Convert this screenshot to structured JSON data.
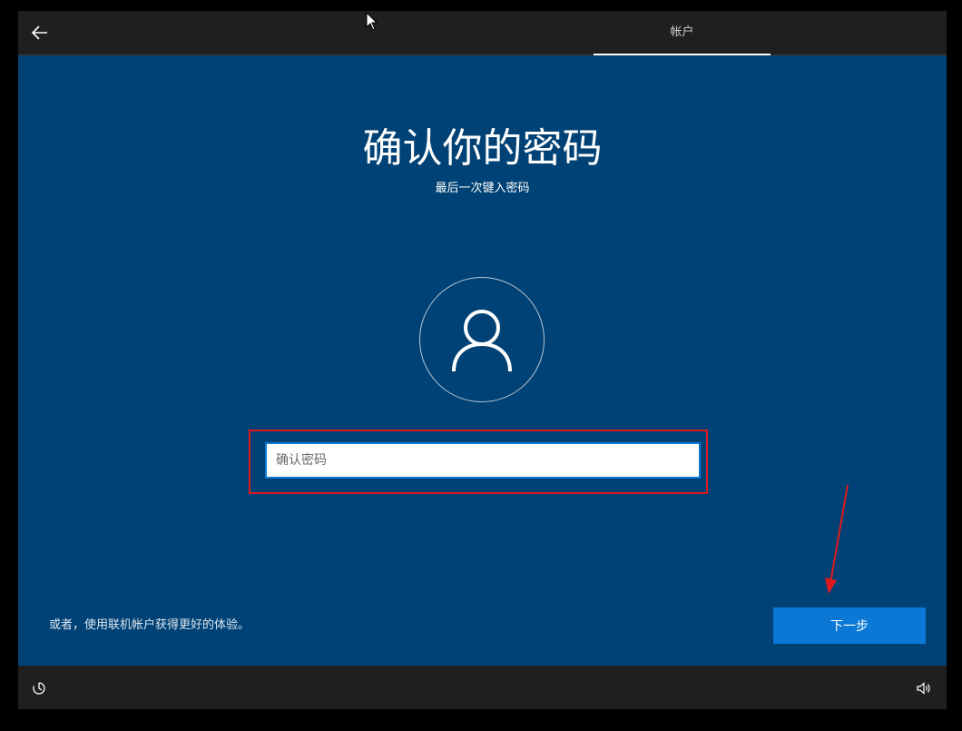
{
  "header": {
    "tab_label": "帐户"
  },
  "main": {
    "title": "确认你的密码",
    "subtitle": "最后一次键入密码",
    "password_placeholder": "确认密码"
  },
  "footer": {
    "online_account_text": "或者，使用联机帐户获得更好的体验。",
    "next_label": "下一步"
  },
  "icons": {
    "back": "back-arrow-icon",
    "avatar": "user-icon",
    "accessibility": "accessibility-icon",
    "volume": "volume-icon",
    "cursor": "mouse-cursor-icon"
  },
  "colors": {
    "background": "#004275",
    "bar": "#1f1f1f",
    "accent": "#0a78d4",
    "annotation": "#e0191e"
  }
}
